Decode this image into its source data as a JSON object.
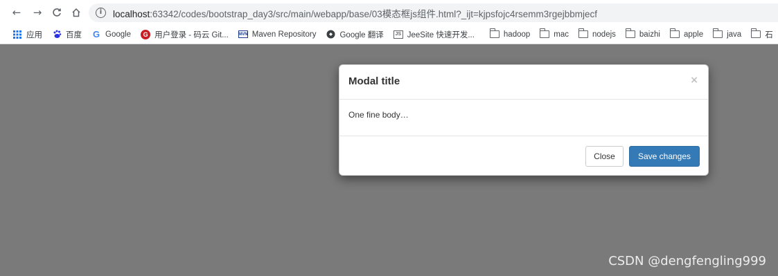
{
  "browser": {
    "url_host": "localhost",
    "url_rest": ":63342/codes/bootstrap_day3/src/main/webapp/base/03模态框js组件.html?_ijt=kjpsfojc4rsemm3rgejbbmjecf",
    "nav": {
      "back_icon": "←",
      "forward_icon": "→",
      "reload_icon": "C",
      "home_icon": "⌂"
    }
  },
  "bookmarks": [
    {
      "label": "应用",
      "icon": "apps-icon"
    },
    {
      "label": "百度",
      "icon": "baidu-icon"
    },
    {
      "label": "Google",
      "icon": "google-icon"
    },
    {
      "label": "用户登录 - 码云 Git...",
      "icon": "gitee-icon"
    },
    {
      "label": "Maven Repository",
      "icon": "maven-icon"
    },
    {
      "label": "Google 翻译",
      "icon": "translate-icon"
    },
    {
      "label": "JeeSite 快速开发...",
      "icon": "jeesite-icon"
    },
    {
      "label": "hadoop",
      "icon": "folder-icon"
    },
    {
      "label": "mac",
      "icon": "folder-icon"
    },
    {
      "label": "nodejs",
      "icon": "folder-icon"
    },
    {
      "label": "baizhi",
      "icon": "folder-icon"
    },
    {
      "label": "apple",
      "icon": "folder-icon"
    },
    {
      "label": "java",
      "icon": "folder-icon"
    },
    {
      "label": "石",
      "icon": "folder-icon"
    }
  ],
  "modal": {
    "title": "Modal title",
    "close_symbol": "×",
    "body": "One fine body…",
    "close_button": "Close",
    "save_button": "Save changes"
  },
  "watermark": "CSDN @dengfengling999",
  "colors": {
    "backdrop": "#7a7a7a",
    "primary": "#337ab7"
  }
}
